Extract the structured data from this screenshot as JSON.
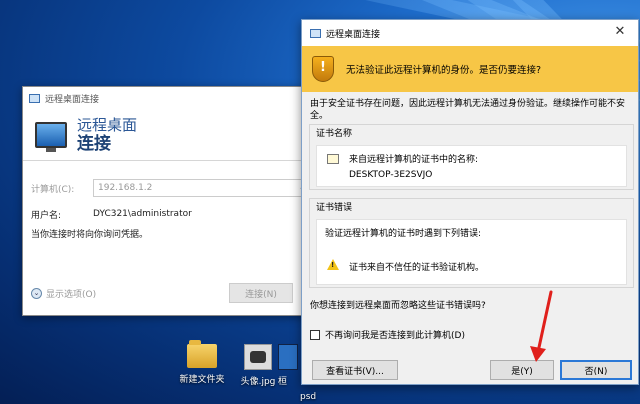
{
  "back_dialog": {
    "title": "远程桌面连接",
    "banner_line1": "远程桌面",
    "banner_line2": "连接",
    "computer_label": "计算机(C):",
    "computer_value": "192.168.1.2",
    "user_label": "用户名:",
    "user_value": "DYC321\\administrator",
    "hint": "当你连接时将向你询问凭据。",
    "options_label": "显示选项(O)",
    "connect_button": "连接(N)"
  },
  "cert_dialog": {
    "title": "远程桌面连接",
    "close": "✕",
    "warning": "无法验证此远程计算机的身份。是否仍要连接?",
    "description": "由于安全证书存在问题，因此远程计算机无法通过身份验证。继续操作可能不安全。",
    "cert_name_group": "证书名称",
    "cert_name_text": "来自远程计算机的证书中的名称:",
    "cert_name_value": "DESKTOP-3E2SVJO",
    "cert_error_group": "证书错误",
    "cert_error_text": "验证远程计算机的证书时遇到下列错误:",
    "cert_error_item": "证书来自不信任的证书验证机构。",
    "question": "你想连接到远程桌面而忽略这些证书错误吗?",
    "dont_ask_label": "不再询问我是否连接到此计算机(D)",
    "view_cert_button": "查看证书(V)...",
    "yes_button": "是(Y)",
    "no_button": "否(N)"
  },
  "desktop_icons": [
    {
      "label": "新建文件夹",
      "icon": "folder-icon"
    },
    {
      "label": "头像.jpg",
      "icon": "image-file-icon"
    },
    {
      "label": "桓",
      "icon": "file-icon"
    }
  ],
  "desktop_extra_label": "psd"
}
